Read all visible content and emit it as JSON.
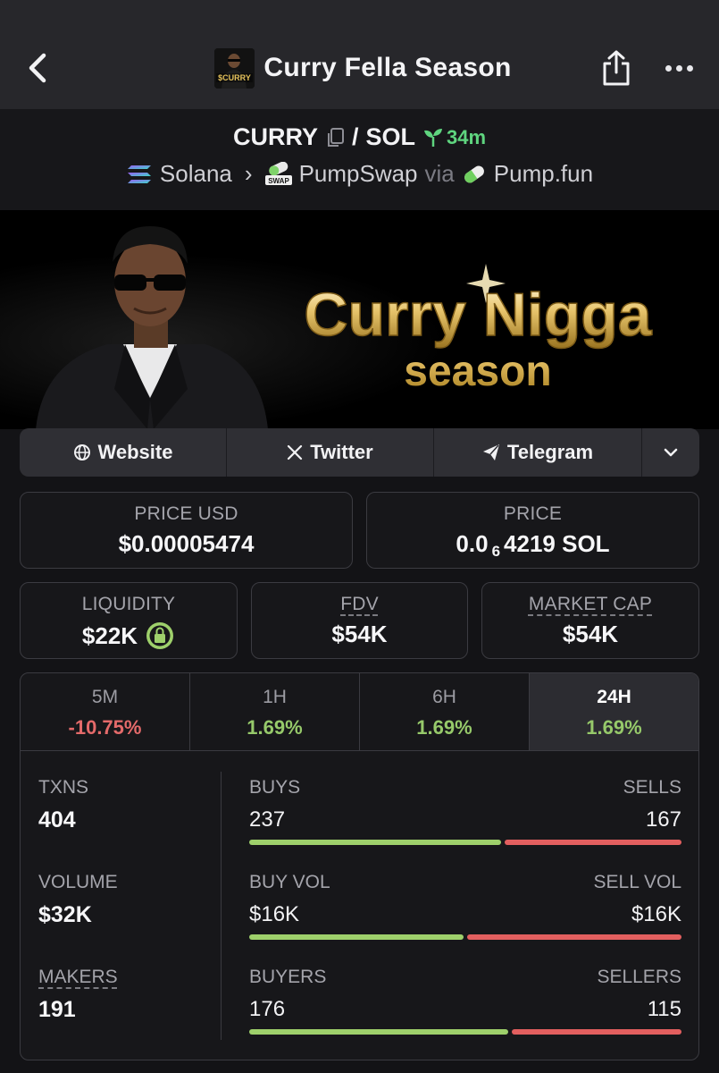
{
  "nav": {
    "title": "Curry Fella Season",
    "avatar_text": "$CURRY",
    "icons": [
      "chevron-left-icon",
      "share-icon",
      "more-icon"
    ]
  },
  "pair": {
    "base": "CURRY",
    "quote": "SOL",
    "separator": "/",
    "age": "34m",
    "chain": "Solana",
    "dex": "PumpSwap",
    "via_label": "via",
    "launchpad": "Pump.fun"
  },
  "banner": {
    "line1": "Curry Nigga",
    "line2": "season"
  },
  "links": {
    "website": "Website",
    "twitter": "Twitter",
    "telegram": "Telegram"
  },
  "price": {
    "usd_label": "PRICE USD",
    "usd_value": "$0.00005474",
    "native_label": "PRICE",
    "native_prefix": "0.0",
    "native_zeros": "6",
    "native_digits": "4219 SOL"
  },
  "metrics": {
    "liquidity_label": "LIQUIDITY",
    "liquidity_value": "$22K",
    "fdv_label": "FDV",
    "fdv_value": "$54K",
    "mcap_label": "MARKET CAP",
    "mcap_value": "$54K"
  },
  "tabs": [
    {
      "label": "5M",
      "value": "-10.75%"
    },
    {
      "label": "1H",
      "value": "1.69%"
    },
    {
      "label": "6H",
      "value": "1.69%"
    },
    {
      "label": "24H",
      "value": "1.69%"
    }
  ],
  "stats": {
    "txns_label": "TXNS",
    "txns_value": "404",
    "volume_label": "VOLUME",
    "volume_value": "$32K",
    "makers_label": "MAKERS",
    "makers_value": "191",
    "buys_label": "BUYS",
    "buys_value": "237",
    "sells_label": "SELLS",
    "sells_value": "167",
    "buyvol_label": "BUY VOL",
    "buyvol_value": "$16K",
    "sellvol_label": "SELL VOL",
    "sellvol_value": "$16K",
    "buyers_label": "BUYERS",
    "buyers_value": "176",
    "sellers_label": "SELLERS",
    "sellers_value": "115"
  },
  "ratios": {
    "buys_share": 0.587,
    "buyvol_share": 0.5,
    "buyers_share": 0.605
  },
  "colors": {
    "positive": "#96c96a",
    "negative": "#e46a6a",
    "age_green": "#5fd57f",
    "bar_green": "#9ed06b",
    "bar_red": "#e35f5f",
    "gold": "#d9b84a"
  }
}
